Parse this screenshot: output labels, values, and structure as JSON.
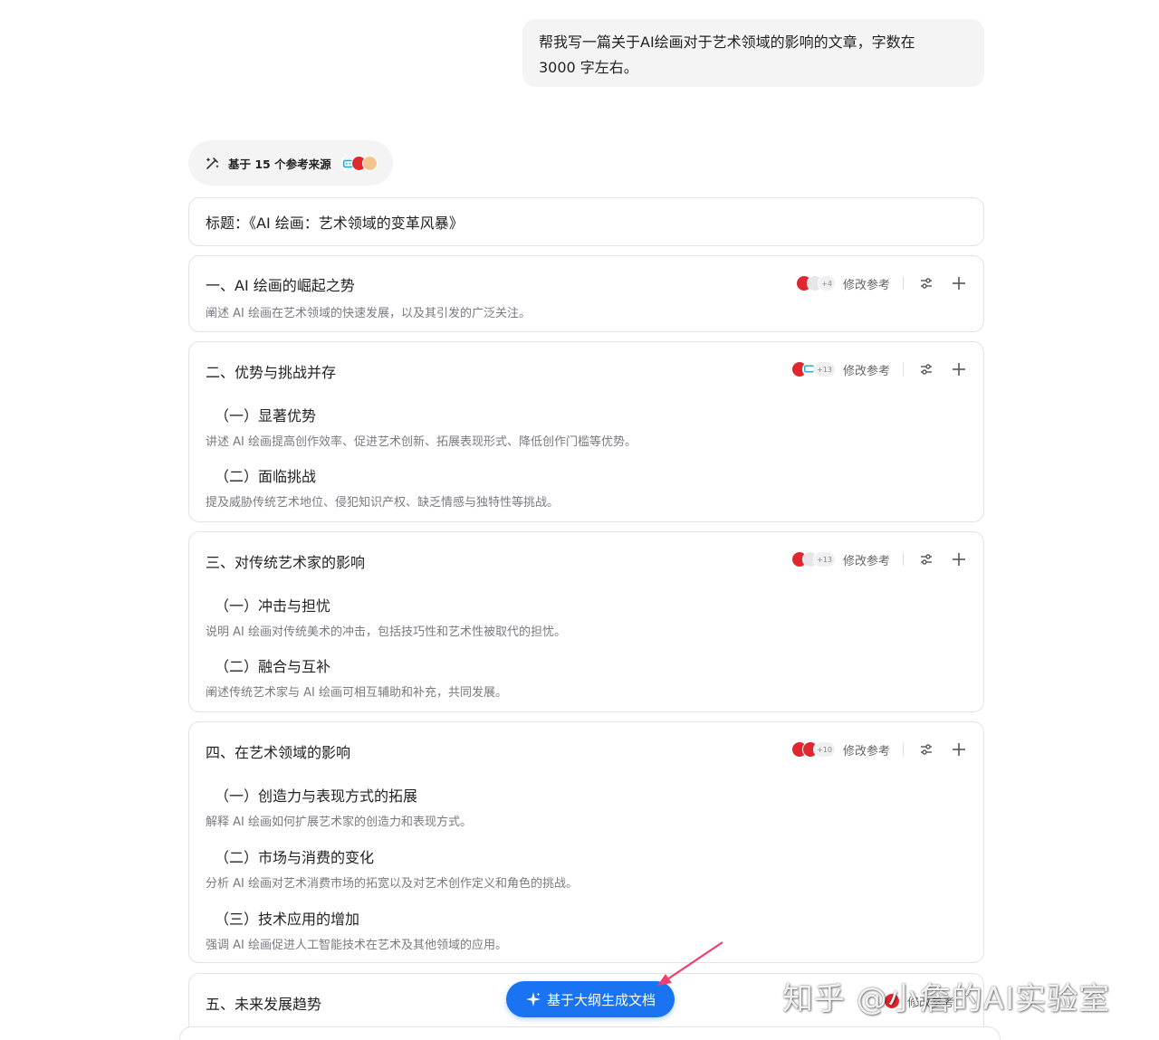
{
  "user_message": {
    "line1": "帮我写一篇关于AI绘画对于艺术领域的影响的文章，字数在",
    "line2": "3000 字左右。"
  },
  "refs": {
    "label": "基于 15 个参考来源"
  },
  "title_card": {
    "text": "标题：《AI 绘画：艺术领域的变革风暴》"
  },
  "modify_label": "修改参考",
  "sections": [
    {
      "heading": "一、AI 绘画的崛起之势",
      "desc": "阐述 AI 绘画在艺术领域的快速发展，以及其引发的广泛关注。",
      "ref_count": "+4",
      "subs": []
    },
    {
      "heading": "二、优势与挑战并存",
      "ref_count": "+13",
      "subs": [
        {
          "title": "（一）显著优势",
          "desc": "讲述 AI 绘画提高创作效率、促进艺术创新、拓展表现形式、降低创作门槛等优势。"
        },
        {
          "title": "（二）面临挑战",
          "desc": "提及威胁传统艺术地位、侵犯知识产权、缺乏情感与独特性等挑战。"
        }
      ]
    },
    {
      "heading": "三、对传统艺术家的影响",
      "ref_count": "+13",
      "subs": [
        {
          "title": "（一）冲击与担忧",
          "desc": "说明 AI 绘画对传统美术的冲击，包括技巧性和艺术性被取代的担忧。"
        },
        {
          "title": "（二）融合与互补",
          "desc": "阐述传统艺术家与 AI 绘画可相互辅助和补充，共同发展。"
        }
      ]
    },
    {
      "heading": "四、在艺术领域的影响",
      "ref_count": "+10",
      "subs": [
        {
          "title": "（一）创造力与表现方式的拓展",
          "desc": "解释 AI 绘画如何扩展艺术家的创造力和表现方式。"
        },
        {
          "title": "（二）市场与消费的变化",
          "desc": "分析 AI 绘画对艺术消费市场的拓宽以及对艺术创作定义和角色的挑战。"
        },
        {
          "title": "（三）技术应用的增加",
          "desc": "强调 AI 绘画促进人工智能技术在艺术及其他领域的应用。"
        }
      ]
    },
    {
      "heading": "五、未来发展趋势"
    }
  ],
  "fab": {
    "label": "基于大纲生成文档"
  },
  "watermark": "知乎 @小詹的AI实验室",
  "colors": {
    "accent": "#1a73f0",
    "source_red": "#e0262f",
    "muted_text": "#7a7a80"
  }
}
